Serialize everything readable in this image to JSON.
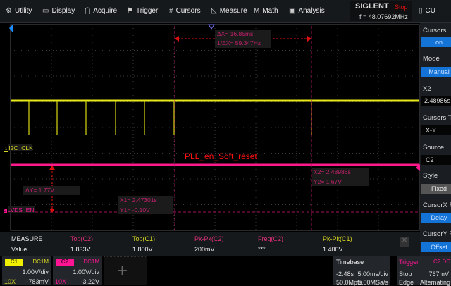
{
  "menu": [
    {
      "label": "Utility",
      "icon": "gear-icon",
      "glyph": "⚙"
    },
    {
      "label": "Display",
      "icon": "monitor-icon",
      "glyph": "▭"
    },
    {
      "label": "Acquire",
      "icon": "acquire-icon",
      "glyph": "⋂"
    },
    {
      "label": "Trigger",
      "icon": "flag-icon",
      "glyph": "⚑"
    },
    {
      "label": "Cursors",
      "icon": "hash-icon",
      "glyph": "#"
    },
    {
      "label": "Measure",
      "icon": "measure-icon",
      "glyph": "◺"
    },
    {
      "label": "Math",
      "icon": "math-icon",
      "glyph": "M"
    },
    {
      "label": "Analysis",
      "icon": "analysis-icon",
      "glyph": "▣"
    }
  ],
  "brand": {
    "name": "SIGLENT",
    "status": "Stop",
    "freq": "f = 48.07692MHz",
    "cu": "CU"
  },
  "screen": {
    "dx": "ΔX= 16.85ms",
    "inv_dx": "1/ΔX= 59.347Hz",
    "c1_label": "I2C_CLK",
    "c2_label": "LVDS_EN",
    "annotation": "PLL_en_Soft_reset",
    "x2": "X2= 2.48986s",
    "y2": "Y2= 1.67V",
    "dy": "ΔY= 1.77V",
    "x1": "X1= 2.47301s",
    "y1": "Y1= -0.10V",
    "c1_marker": "1",
    "c2_marker": "2"
  },
  "side": {
    "cursors_label": "Cursors",
    "cursors_value": "on",
    "mode_label": "Mode",
    "mode_value": "Manual",
    "x2_label": "X2",
    "x2_value": "2.48986s",
    "type_label": "Cursors T",
    "type_value": "X-Y",
    "source_label": "Source",
    "source_value": "C2",
    "style_label": "Style",
    "style_value": "Fixed",
    "cxr_label": "CursorX R",
    "cxr_value": "Delay",
    "cyr_label": "CursorY R",
    "cyr_value": "Offset"
  },
  "measure": {
    "title": "MEASURE",
    "row_label": "Value",
    "items": [
      {
        "name": "Top(C2)",
        "value": "1.833V",
        "color": "#e0307a"
      },
      {
        "name": "Top(C1)",
        "value": "1.800V",
        "color": "#d8d820"
      },
      {
        "name": "Pk-Pk(C2)",
        "value": "200mV",
        "color": "#e0307a"
      },
      {
        "name": "Freq(C2)",
        "value": "***",
        "color": "#e0307a"
      },
      {
        "name": "Pk-Pk(C1)",
        "value": "1.400V",
        "color": "#d8d820"
      }
    ]
  },
  "c1": {
    "tag": "C1",
    "coupling": "DC1M",
    "scale": "1.00V/div",
    "probe": "10X",
    "offset": "-783mV",
    "color": "#f0f000"
  },
  "c2": {
    "tag": "C2",
    "coupling": "DC1M",
    "scale": "1.00V/div",
    "probe": "10X",
    "offset": "-3.22V",
    "color": "#ff1493"
  },
  "timebase": {
    "title": "Timebase",
    "delay": "-2.48s",
    "scale": "5.00ms/div",
    "points": "50.0Mpts",
    "rate": "5.00MSa/s"
  },
  "trigger": {
    "title": "Trigger",
    "source": "C2 DC",
    "state": "Stop",
    "level": "767mV",
    "type": "Edge",
    "mode": "Alternating"
  }
}
